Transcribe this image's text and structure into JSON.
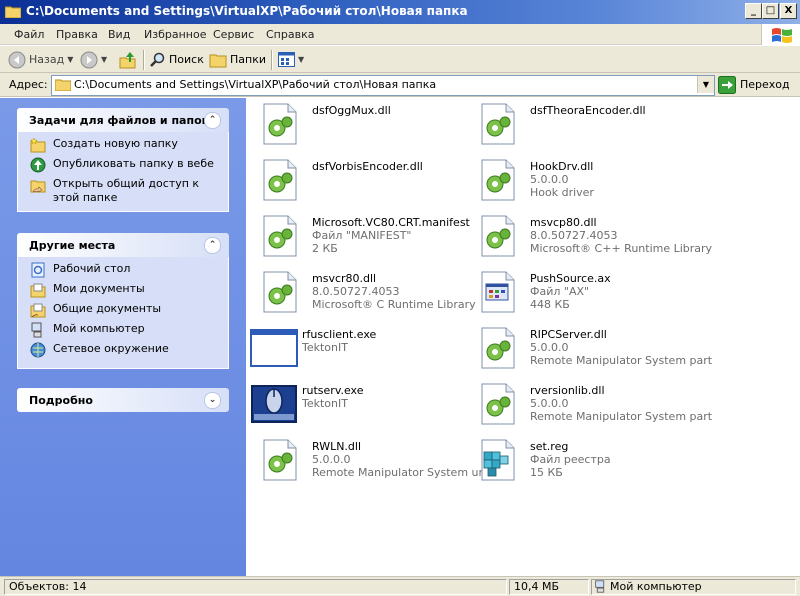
{
  "window": {
    "title": "C:\\Documents and Settings\\VirtualXP\\Рабочий стол\\Новая папка",
    "controls": {
      "minimize": "_",
      "maximize": "□",
      "close": "X"
    }
  },
  "menu": [
    "Файл",
    "Правка",
    "Вид",
    "Избранное",
    "Сервис",
    "Справка"
  ],
  "toolbar": {
    "back": "Назад",
    "search": "Поиск",
    "folders": "Папки"
  },
  "address": {
    "label": "Адрес:",
    "value": "C:\\Documents and Settings\\VirtualXP\\Рабочий стол\\Новая папка",
    "go": "Переход"
  },
  "tasks": {
    "title": "Задачи для файлов и папок",
    "chevron": "⌃",
    "items": [
      {
        "label": "Создать новую папку",
        "icon": "new-folder-icon"
      },
      {
        "label": "Опубликовать папку в вебе",
        "icon": "publish-web-icon"
      },
      {
        "label": "Открыть общий доступ к этой папке",
        "icon": "share-folder-icon"
      }
    ]
  },
  "places": {
    "title": "Другие места",
    "chevron": "⌃",
    "items": [
      {
        "label": "Рабочий стол",
        "icon": "desktop-icon"
      },
      {
        "label": "Мои документы",
        "icon": "my-documents-icon"
      },
      {
        "label": "Общие документы",
        "icon": "shared-documents-icon"
      },
      {
        "label": "Мой компьютер",
        "icon": "my-computer-icon"
      },
      {
        "label": "Сетевое окружение",
        "icon": "network-icon"
      }
    ]
  },
  "details": {
    "title": "Подробно",
    "chevron": "⌄"
  },
  "files": [
    {
      "name": "dsfOggMux.dll",
      "line2": "",
      "line3": "",
      "icon": "dll-icon"
    },
    {
      "name": "dsfTheoraEncoder.dll",
      "line2": "",
      "line3": "",
      "icon": "dll-icon"
    },
    {
      "name": "dsfVorbisEncoder.dll",
      "line2": "",
      "line3": "",
      "icon": "dll-icon"
    },
    {
      "name": "HookDrv.dll",
      "line2": "5.0.0.0",
      "line3": "Hook driver",
      "icon": "dll-icon"
    },
    {
      "name": "Microsoft.VC80.CRT.manifest",
      "line2": "Файл \"MANIFEST\"",
      "line3": "2 КБ",
      "icon": "dll-icon"
    },
    {
      "name": "msvcp80.dll",
      "line2": "8.0.50727.4053",
      "line3": "Microsoft® C++ Runtime Library",
      "icon": "dll-icon"
    },
    {
      "name": "msvcr80.dll",
      "line2": "8.0.50727.4053",
      "line3": "Microsoft® C Runtime Library",
      "icon": "dll-icon"
    },
    {
      "name": "PushSource.ax",
      "line2": "Файл \"AX\"",
      "line3": "448 КБ",
      "icon": "ax-file-icon"
    },
    {
      "name": "rfusclient.exe",
      "line2": "TektonIT",
      "line3": "",
      "icon": "exe-window-icon"
    },
    {
      "name": "RIPCServer.dll",
      "line2": "5.0.0.0",
      "line3": "Remote Manipulator System part",
      "icon": "dll-icon"
    },
    {
      "name": "rutserv.exe",
      "line2": "TektonIT",
      "line3": "",
      "icon": "mouse-exe-icon"
    },
    {
      "name": "rversionlib.dll",
      "line2": "5.0.0.0",
      "line3": "Remote Manipulator System part",
      "icon": "dll-icon"
    },
    {
      "name": "RWLN.dll",
      "line2": "5.0.0.0",
      "line3": "Remote Manipulator System unit",
      "icon": "dll-icon"
    },
    {
      "name": "set.reg",
      "line2": "Файл реестра",
      "line3": "15 КБ",
      "icon": "registry-file-icon"
    }
  ],
  "status": {
    "objects": "Объектов: 14",
    "size": "10,4 МБ",
    "location": "Мой компьютер"
  }
}
